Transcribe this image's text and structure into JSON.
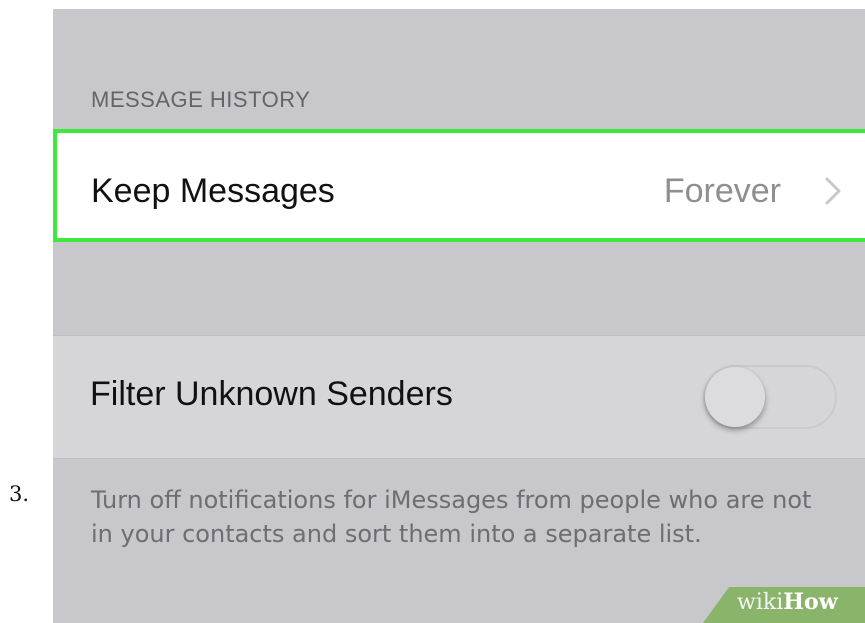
{
  "step": {
    "number": "3."
  },
  "message_history": {
    "header": "MESSAGE HISTORY",
    "keep_messages": {
      "label": "Keep Messages",
      "value": "Forever",
      "highlighted": true,
      "highlight_color": "#3fe83d"
    }
  },
  "filter": {
    "label": "Filter Unknown Senders",
    "toggle_on": false,
    "description": "Turn off notifications for iMessages from people who are not in your contacts and sort them into a separate list."
  },
  "watermark": {
    "wiki": "wiki",
    "how": "How",
    "color": "#8bb46b"
  },
  "colors": {
    "background": "#c8c7cc",
    "row_background": "#ffffff",
    "secondary_text": "#8e8e93"
  }
}
